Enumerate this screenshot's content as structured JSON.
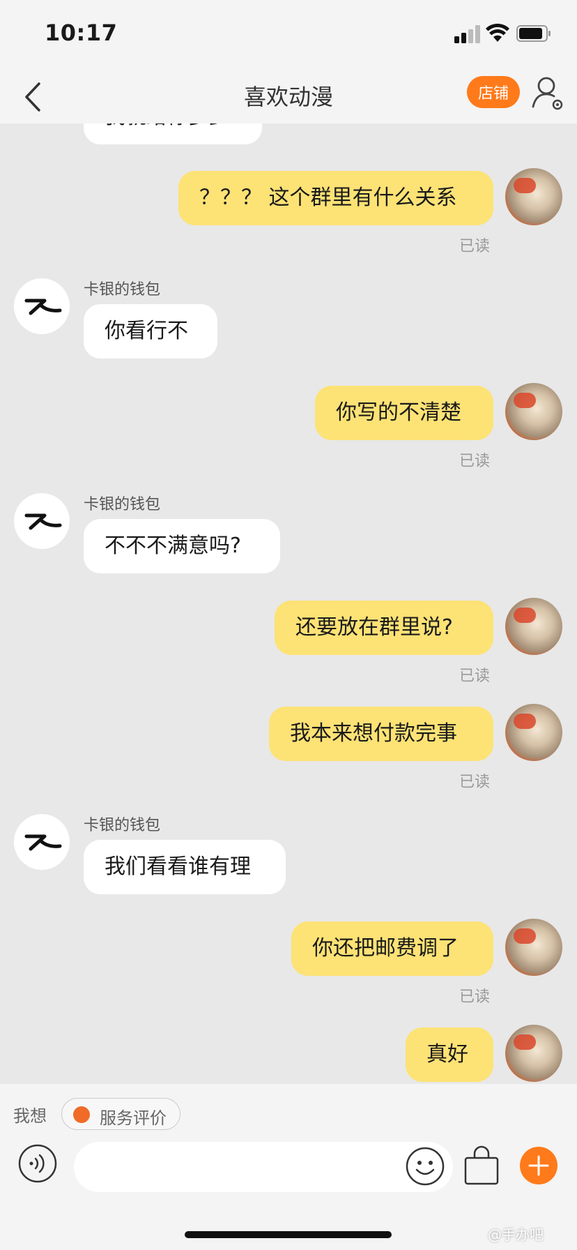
{
  "status_bar": {
    "time": "10:17"
  },
  "nav": {
    "title": "喜欢动漫",
    "shop_label": "店铺"
  },
  "chat": {
    "partial_top_message": "我就给你多少",
    "read_label": "已读",
    "incoming_sender": "卡银的钱包",
    "messages": [
      {
        "direction": "out",
        "text": "？？？ 这个群里有什么关系",
        "read": "已读"
      },
      {
        "direction": "in",
        "sender": "卡银的钱包",
        "text": "你看行不"
      },
      {
        "direction": "out",
        "text": "你写的不清楚",
        "read": "已读"
      },
      {
        "direction": "in",
        "sender": "卡银的钱包",
        "text": "不不不满意吗?"
      },
      {
        "direction": "out",
        "text": "还要放在群里说?",
        "read": "已读"
      },
      {
        "direction": "out",
        "text": "我本来想付款完事",
        "read": "已读"
      },
      {
        "direction": "in",
        "sender": "卡银的钱包",
        "text": "我们看看谁有理"
      },
      {
        "direction": "out",
        "text": "你还把邮费调了",
        "read": "已读"
      },
      {
        "direction": "out",
        "text": "真好"
      }
    ]
  },
  "bottom": {
    "wish_label": "我想",
    "service_chip": "服务评价",
    "input_placeholder": "",
    "watermark": "@手办吧"
  },
  "colors": {
    "accent": "#ff7a1a",
    "outgoing_bubble": "#fde275",
    "incoming_bubble": "#ffffff",
    "background": "#e8e8e8"
  },
  "icons": [
    "back-chevron-icon",
    "user-settings-icon",
    "voice-icon",
    "emoji-icon",
    "shopping-bag-icon",
    "plus-icon",
    "signal-icon",
    "wifi-icon",
    "battery-icon"
  ]
}
